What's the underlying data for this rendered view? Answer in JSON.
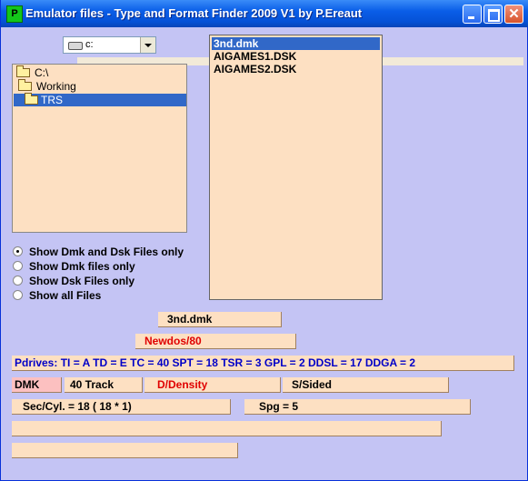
{
  "window": {
    "title": "Emulator files - Type and Format Finder 2009  V1    by P.Ereaut",
    "app_icon": "P"
  },
  "drive": {
    "selected": "c:"
  },
  "directories": [
    {
      "label": "C:\\",
      "selected": false
    },
    {
      "label": "Working",
      "selected": false
    },
    {
      "label": "TRS",
      "selected": true
    }
  ],
  "files": [
    {
      "label": "3nd.dmk",
      "selected": true
    },
    {
      "label": "AIGAMES1.DSK",
      "selected": false
    },
    {
      "label": "AIGAMES2.DSK",
      "selected": false
    }
  ],
  "filters": [
    {
      "label": "Show Dmk and Dsk Files only",
      "checked": true
    },
    {
      "label": "Show Dmk files only",
      "checked": false
    },
    {
      "label": "Show Dsk Files only",
      "checked": false
    },
    {
      "label": "Show all Files",
      "checked": false
    }
  ],
  "info": {
    "filename": "3nd.dmk",
    "dos": "Newdos/80",
    "pdrives": "Pdrives: TI = A   TD = E  TC = 40   SPT = 18  TSR = 3  GPL = 2  DDSL = 17  DDGA = 2",
    "type": "DMK",
    "tracks": "40 Track",
    "density": "D/Density",
    "sides": "S/Sided",
    "sec_cyl": "Sec/Cyl. = 18 ( 18 * 1)",
    "spg": "Spg = 5",
    "extra1": "",
    "extra2": ""
  },
  "colors": {
    "background": "#c4c4f4",
    "panel": "#fde0c2",
    "selection": "#3168c8",
    "pdrives_text": "#0000c8",
    "warning_text": "#e00000",
    "dmk_bg": "#fcc0c0"
  }
}
